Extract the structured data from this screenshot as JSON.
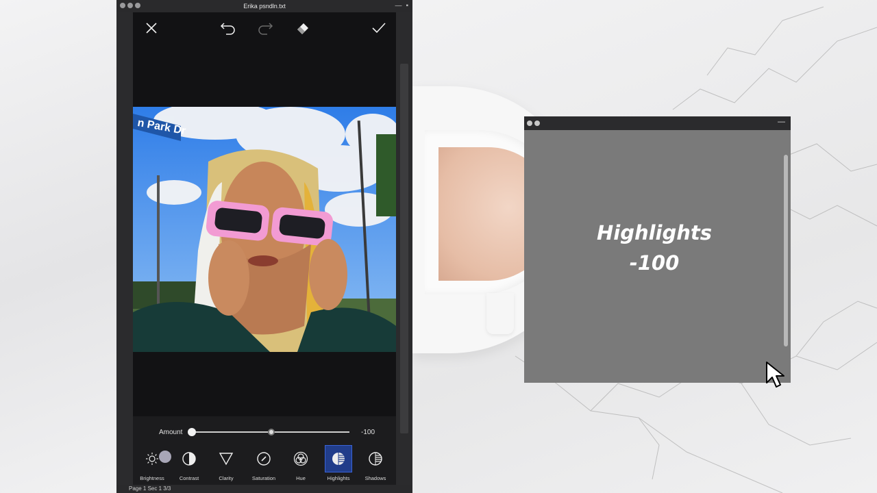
{
  "window": {
    "title": "Erika psndln.txt",
    "status": "Page 1  Sec 1   3/3"
  },
  "toolbar": {
    "close_icon": "close-icon",
    "undo_icon": "undo-icon",
    "redo_icon": "redo-icon",
    "eraser_icon": "eraser-icon",
    "confirm_icon": "check-icon"
  },
  "adjust": {
    "amount_label": "Amount",
    "amount_value": "-100",
    "amount_fraction": 0.0
  },
  "tools": [
    {
      "label": "Brightness",
      "icon": "sun-icon",
      "active": false
    },
    {
      "label": "Contrast",
      "icon": "contrast-icon",
      "active": false
    },
    {
      "label": "Clarity",
      "icon": "triangle-icon",
      "active": false
    },
    {
      "label": "Saturation",
      "icon": "dial-icon",
      "active": false
    },
    {
      "label": "Hue",
      "icon": "hue-icon",
      "active": false
    },
    {
      "label": "Highlights",
      "icon": "highlights-icon",
      "active": true
    },
    {
      "label": "Shadows",
      "icon": "shadows-icon",
      "active": false
    }
  ],
  "photo": {
    "street_sign": "n Park Dr"
  },
  "overlay": {
    "line1": "Highlights",
    "line2": "-100"
  },
  "colors": {
    "active_tool": "#213d8a",
    "overlay_bg": "#7a7a7a"
  }
}
